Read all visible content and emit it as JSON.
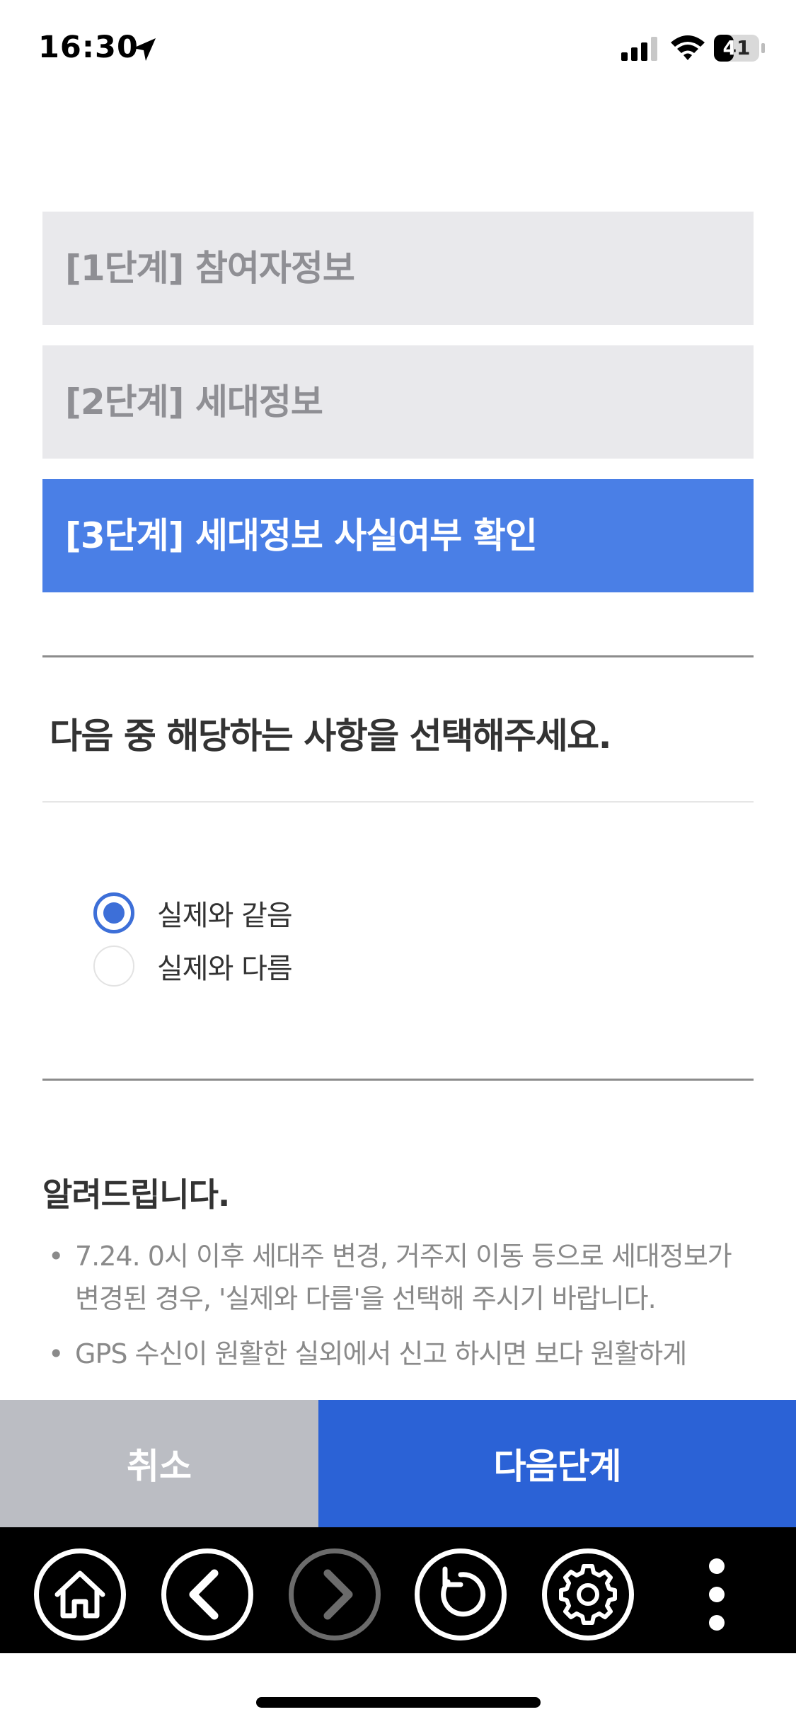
{
  "status_bar": {
    "time": "16:30",
    "battery": "41",
    "icons": [
      "location-arrow-icon",
      "signal-icon",
      "wifi-icon",
      "battery-icon"
    ]
  },
  "steps": [
    {
      "label": "[1단계] 참여자정보",
      "active": false
    },
    {
      "label": "[2단계] 세대정보",
      "active": false
    },
    {
      "label": "[3단계] 세대정보 사실여부 확인",
      "active": true
    }
  ],
  "question": "다음 중 해당하는 사항을 선택해주세요.",
  "options": [
    {
      "label": "실제와 같음",
      "selected": true
    },
    {
      "label": "실제와 다름",
      "selected": false
    }
  ],
  "notice": {
    "title": "알려드립니다.",
    "items": [
      "7.24. 0시 이후 세대주 변경, 거주지 이동 등으로 세대정보가 변경된 경우, '실제와 다름'을 선택해 주시기 바랍니다.",
      "GPS 수신이 원활한 실외에서 신고 하시면 보다 원활하게"
    ]
  },
  "actions": {
    "cancel": "취소",
    "next": "다음단계"
  },
  "toolbar": {
    "icons": [
      "home-icon",
      "back-icon",
      "forward-icon",
      "reload-icon",
      "settings-icon",
      "more-icon"
    ]
  },
  "colors": {
    "active_step": "#4a7fe6",
    "inactive_step": "#e9e9ec",
    "next_button": "#2b62d6",
    "cancel_button": "#bbbdc3",
    "radio_checked": "#3d6fd8"
  }
}
